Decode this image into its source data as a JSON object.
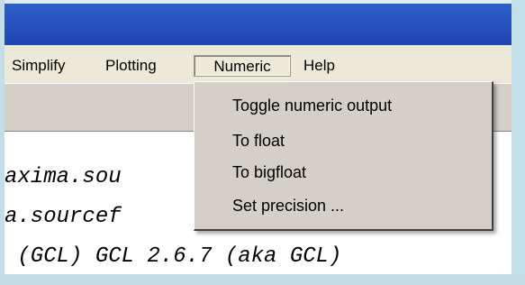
{
  "menu_bar": {
    "items": [
      {
        "label": "Simplify"
      },
      {
        "label": "Plotting"
      },
      {
        "label": "Numeric",
        "active": true
      },
      {
        "label": "Help"
      }
    ]
  },
  "numeric_menu": {
    "items": [
      {
        "label": "Toggle numeric output"
      },
      {
        "label": "To float"
      },
      {
        "label": "To bigfloat"
      },
      {
        "label": "Set precision ..."
      }
    ]
  },
  "console": {
    "lines": [
      "axima.sou",
      "a.sourcef",
      " (GCL) GCL 2.6.7 (aka GCL)"
    ]
  },
  "colors": {
    "title_bar": "#2a54c0",
    "menu_background": "#ece9d8",
    "dropdown_background": "#d4d0c8"
  }
}
